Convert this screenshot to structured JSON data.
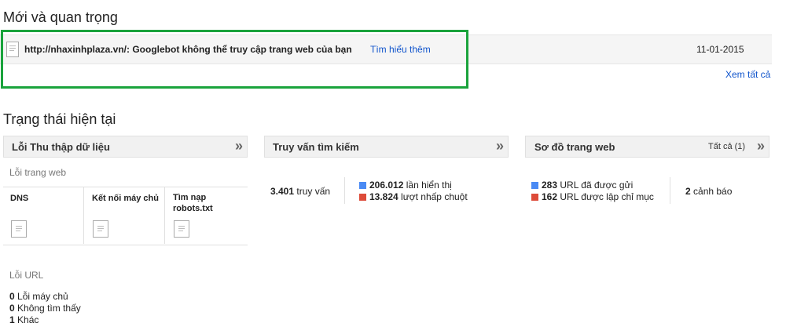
{
  "new_important": {
    "title": "Mới và quan trọng",
    "notice": {
      "message": "http://nhaxinhplaza.vn/: Googlebot không thể truy cập trang web của bạn",
      "learn_more": "Tìm hiểu thêm",
      "date": "11-01-2015"
    },
    "see_all": "Xem tất cả"
  },
  "current_status": {
    "title": "Trạng thái hiện tại",
    "crawl_errors": {
      "title": "Lỗi Thu thập dữ liệu",
      "site_errors_label": "Lỗi trang web",
      "columns": [
        "DNS",
        "Kết nối máy chủ",
        "Tìm nạp robots.txt"
      ],
      "url_errors_label": "Lỗi URL",
      "url_errors": [
        {
          "count": "0",
          "label": "Lỗi máy chủ"
        },
        {
          "count": "0",
          "label": "Không tìm thấy"
        },
        {
          "count": "1",
          "label": "Khác"
        }
      ]
    },
    "search_queries": {
      "title": "Truy vấn tìm kiếm",
      "queries_count": "3.401",
      "queries_label": "truy vấn",
      "impressions_count": "206.012",
      "impressions_label": "lần hiển thị",
      "clicks_count": "13.824",
      "clicks_label": "lượt nhấp chuột",
      "impressions_color": "#4a8af4",
      "clicks_color": "#dd4b39"
    },
    "sitemaps": {
      "title": "Sơ đồ trang web",
      "all_link": "Tất cả (1)",
      "submitted_count": "283",
      "submitted_label": "URL đã được gửi",
      "indexed_count": "162",
      "indexed_label": "URL được lập chỉ mục",
      "warnings_count": "2",
      "warnings_label": "cảnh báo",
      "submitted_color": "#4a8af4",
      "indexed_color": "#dd4b39"
    }
  },
  "colors": {
    "highlight_box": "#1aa33c",
    "link": "#1155cc"
  }
}
